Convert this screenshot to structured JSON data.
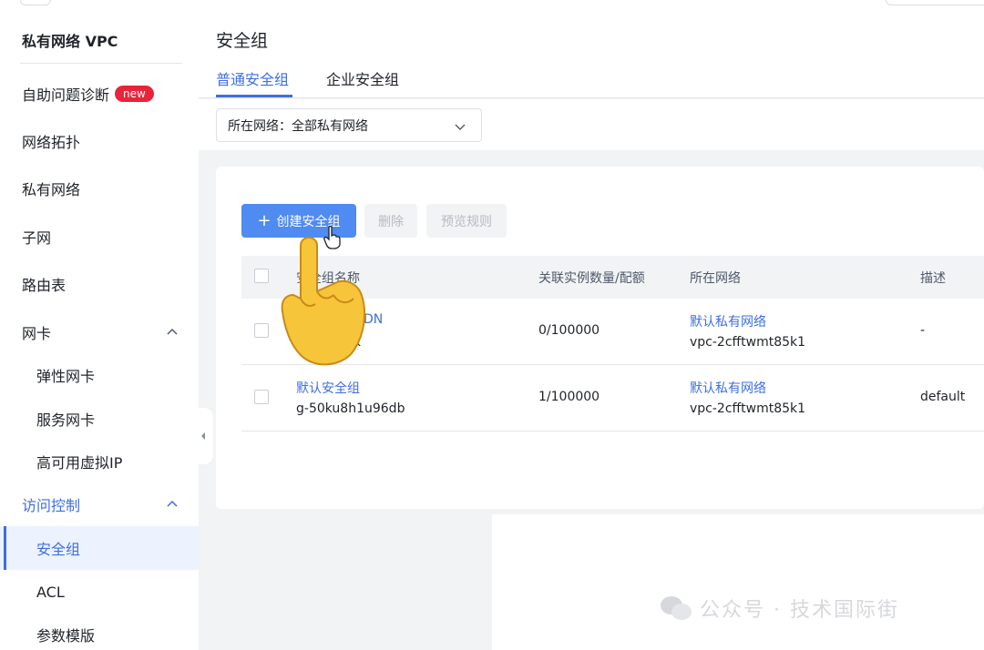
{
  "sidebar": {
    "title": "私有网络 VPC",
    "items": [
      {
        "label": "自助问题诊断",
        "badge": "new"
      },
      {
        "label": "网络拓扑"
      },
      {
        "label": "私有网络"
      },
      {
        "label": "子网"
      },
      {
        "label": "路由表"
      },
      {
        "label": "网卡"
      },
      {
        "label": "弹性网卡"
      },
      {
        "label": "服务网卡"
      },
      {
        "label": "高可用虚拟IP"
      },
      {
        "label": "访问控制"
      },
      {
        "label": "安全组"
      },
      {
        "label": "ACL"
      },
      {
        "label": "参数模版"
      }
    ]
  },
  "header": {
    "title": "安全组",
    "tabs": [
      "普通安全组",
      "企业安全组"
    ]
  },
  "filter": {
    "network_select": "所在网络：全部私有网络"
  },
  "toolbar": {
    "create_label": "创建安全组",
    "delete_label": "删除",
    "preview_label": "预览规则"
  },
  "table": {
    "headers": [
      "安全组名称",
      "关联实例数量/配额",
      "所在网络",
      "描述"
    ],
    "rows": [
      {
        "name": "DN",
        "id": "g-...p1g9k",
        "quota": "0/100000",
        "network": "默认私有网络",
        "vpc_id": "vpc-2cfftwmt85k1",
        "desc": "-"
      },
      {
        "name": "默认安全组",
        "id": "g-50ku8h1u96db",
        "quota": "1/100000",
        "network": "默认私有网络",
        "vpc_id": "vpc-2cfftwmt85k1",
        "desc": "default"
      }
    ]
  },
  "watermark": "公众号 · 技术国际街",
  "colors": {
    "accent": "#3d6fe0",
    "primary_button": "#4f8bf0",
    "badge": "#e8243a"
  }
}
